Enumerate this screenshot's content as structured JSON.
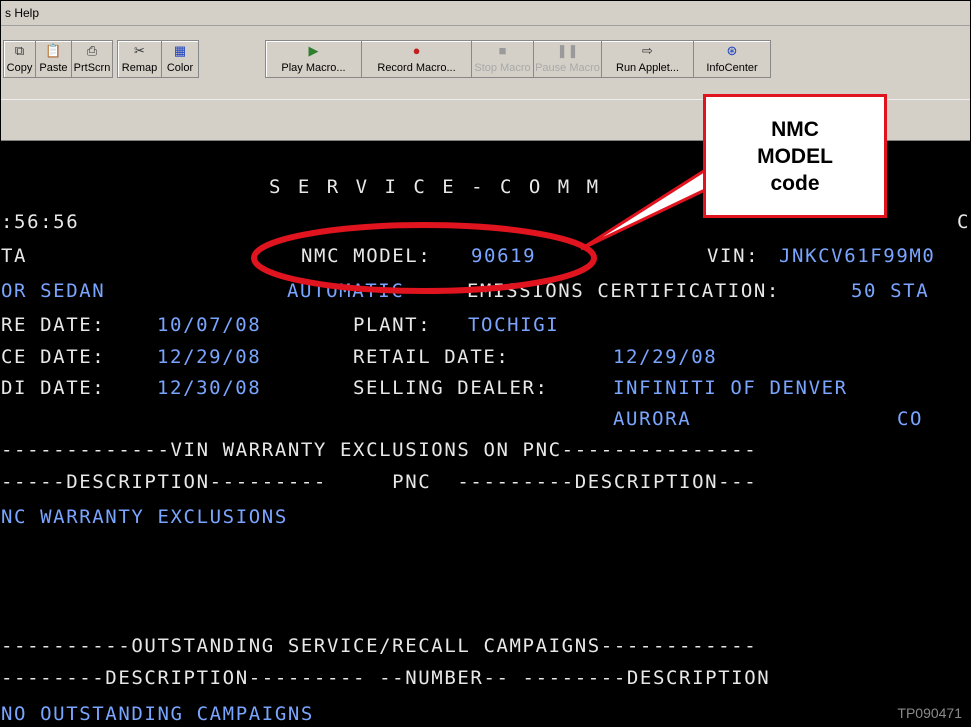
{
  "menubar": {
    "help_label": "s  Help"
  },
  "toolbar": {
    "group1": [
      {
        "label": "Copy",
        "icon": "copy-icon"
      },
      {
        "label": "Paste",
        "icon": "paste-icon"
      },
      {
        "label": "PrtScrn",
        "icon": "print-screen-icon"
      }
    ],
    "group2": [
      {
        "label": "Remap",
        "icon": "remap-icon"
      },
      {
        "label": "Color",
        "icon": "color-icon"
      }
    ],
    "group3": [
      {
        "label": "Play Macro...",
        "icon": "play-macro-icon",
        "enabled": true
      },
      {
        "label": "Record Macro...",
        "icon": "record-macro-icon",
        "enabled": true
      },
      {
        "label": "Stop Macro",
        "icon": "stop-macro-icon",
        "enabled": false
      },
      {
        "label": "Pause Macro",
        "icon": "pause-macro-icon",
        "enabled": false
      },
      {
        "label": "Run Applet...",
        "icon": "run-applet-icon",
        "enabled": true
      },
      {
        "label": "InfoCenter",
        "icon": "infocenter-icon",
        "enabled": true
      }
    ]
  },
  "terminal": {
    "title": "S E R V I C E - C O M M",
    "time": ":56:56",
    "right_c": "C",
    "row_ta": "TA",
    "model_label": "NMC MODEL:",
    "model_value": "90619",
    "vin_label": "VIN:",
    "vin_value": "JNKCV61F99M0",
    "body_style": "OR SEDAN",
    "transmission": "AUTOMATIC",
    "emissions_label": "EMISSIONS CERTIFICATION:",
    "emissions_value": "50 STA",
    "mfg_label": "RE DATE:",
    "mfg_date": "10/07/08",
    "plant_label": "PLANT:",
    "plant_value": "TOCHIGI",
    "service_label": "CE DATE:",
    "service_date": "12/29/08",
    "retail_label": "RETAIL DATE:",
    "retail_date": "12/29/08",
    "pdi_label": "DI DATE:",
    "pdi_date": "12/30/08",
    "dealer_label": "SELLING DEALER:",
    "dealer_name": "INFINITI OF DENVER",
    "dealer_city": "AURORA",
    "dealer_state": "CO",
    "excl_header": "-------------VIN WARRANTY EXCLUSIONS ON PNC---------------",
    "excl_cols": "-----DESCRIPTION---------     PNC  ---------DESCRIPTION---",
    "excl_none": "NC WARRANTY EXCLUSIONS",
    "camp_header": "----------OUTSTANDING SERVICE/RECALL CAMPAIGNS------------",
    "camp_cols": "--------DESCRIPTION--------- --NUMBER-- --------DESCRIPTION",
    "camp_none": "NO OUTSTANDING CAMPAIGNS"
  },
  "callout": {
    "text": "NMC\nMODEL\ncode"
  },
  "watermark": "TP090471",
  "colors": {
    "highlight_red": "#e0141e",
    "terminal_blue": "#7aa5ff",
    "terminal_white": "#e8e8e8"
  }
}
